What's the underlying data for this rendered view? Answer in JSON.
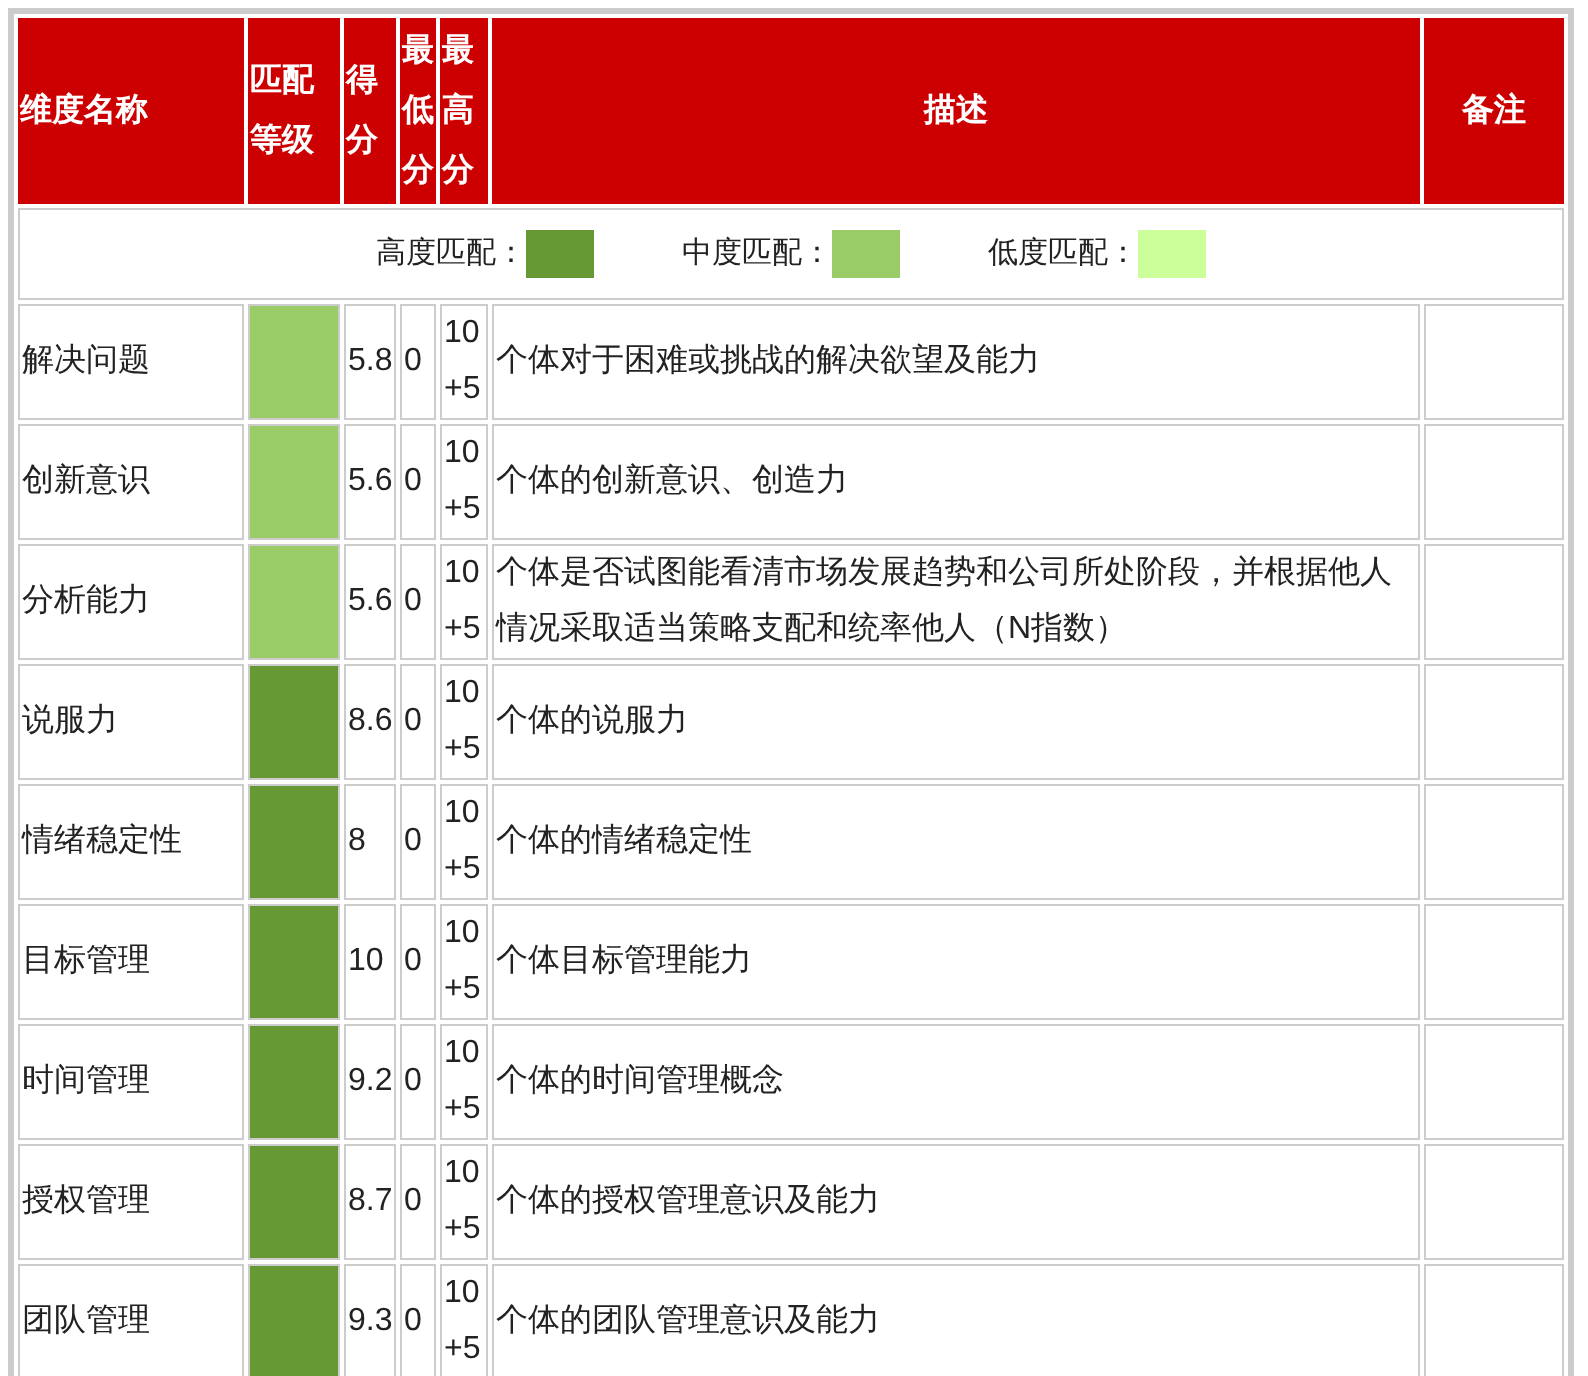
{
  "columns": [
    "维度名称",
    "匹配等级",
    "得分",
    "最低分",
    "最高分",
    "描述",
    "备注"
  ],
  "legend": [
    {
      "label": "高度匹配：",
      "color": "#669933"
    },
    {
      "label": "中度匹配：",
      "color": "#99cc66"
    },
    {
      "label": "低度匹配：",
      "color": "#ccff99"
    }
  ],
  "rows": [
    {
      "name": "解决问题",
      "color": "#99cc66",
      "score": "5.8",
      "min": "0",
      "max": "10 +5",
      "description": "个体对于困难或挑战的解决欲望及能力"
    },
    {
      "name": "创新意识",
      "color": "#99cc66",
      "score": "5.6",
      "min": "0",
      "max": "10 +5",
      "description": "个体的创新意识、创造力"
    },
    {
      "name": "分析能力",
      "color": "#99cc66",
      "score": "5.6",
      "min": "0",
      "max": "10 +5",
      "description": "个体是否试图能看清市场发展趋势和公司所处阶段，并根据他人情况采取适当策略支配和统率他人（N指数）"
    },
    {
      "name": "说服力",
      "color": "#669933",
      "score": "8.6",
      "min": "0",
      "max": "10 +5",
      "description": "个体的说服力"
    },
    {
      "name": "情绪稳定性",
      "color": "#669933",
      "score": "8",
      "min": "0",
      "max": "10 +5",
      "description": "个体的情绪稳定性"
    },
    {
      "name": "目标管理",
      "color": "#669933",
      "score": "10",
      "min": "0",
      "max": "10 +5",
      "description": "个体目标管理能力"
    },
    {
      "name": "时间管理",
      "color": "#669933",
      "score": "9.2",
      "min": "0",
      "max": "10 +5",
      "description": "个体的时间管理概念"
    },
    {
      "name": "授权管理",
      "color": "#669933",
      "score": "8.7",
      "min": "0",
      "max": "10 +5",
      "description": "个体的授权管理意识及能力"
    },
    {
      "name": "团队管理",
      "color": "#669933",
      "score": "9.3",
      "min": "0",
      "max": "10 +5",
      "description": "个体的团队管理意识及能力"
    }
  ]
}
